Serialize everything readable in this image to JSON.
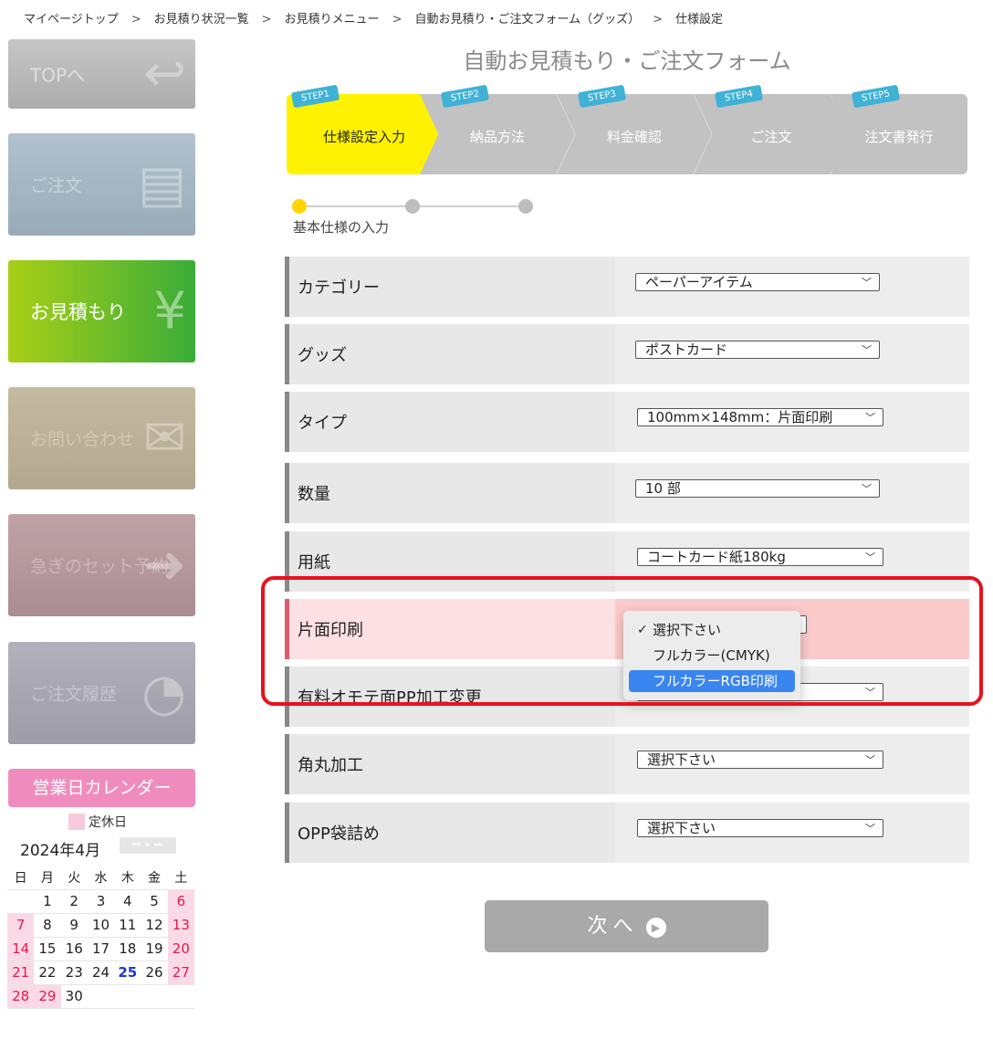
{
  "breadcrumb": {
    "items": [
      "マイページトップ",
      "お見積り状況一覧",
      "お見積りメニュー",
      "自動お見積り・ご注文フォーム（グッズ）",
      "仕様設定"
    ],
    "separator": ">"
  },
  "sidebar": {
    "top": "TOPへ",
    "order": "ご注文",
    "estimate": "お見積もり",
    "contact": "お問い合わせ",
    "rush": "急ぎのセット予約",
    "history": "ご注文履歴"
  },
  "calendar": {
    "title": "営業日カレンダー",
    "legend": "定休日",
    "month": "2024年4月",
    "weekdays": [
      "日",
      "月",
      "火",
      "水",
      "木",
      "金",
      "土"
    ],
    "weeks": [
      [
        "",
        "1",
        "2",
        "3",
        "4",
        "5",
        "6"
      ],
      [
        "7",
        "8",
        "9",
        "10",
        "11",
        "12",
        "13"
      ],
      [
        "14",
        "15",
        "16",
        "17",
        "18",
        "19",
        "20"
      ],
      [
        "21",
        "22",
        "23",
        "24",
        "25",
        "26",
        "27"
      ],
      [
        "28",
        "29",
        "30",
        "",
        "",
        "",
        ""
      ]
    ],
    "holidays": [
      "6",
      "7",
      "13",
      "14",
      "20",
      "21",
      "27",
      "28",
      "29"
    ],
    "today": "25",
    "holiday_color": "#e01a4f",
    "today_color": "#1838d8"
  },
  "form": {
    "title": "自動お見積もり・ご注文フォーム",
    "steps": [
      {
        "tag": "STEP1",
        "name": "仕様設定入力"
      },
      {
        "tag": "STEP2",
        "name": "納品方法"
      },
      {
        "tag": "STEP3",
        "name": "料金確認"
      },
      {
        "tag": "STEP4",
        "name": "ご注文"
      },
      {
        "tag": "STEP5",
        "name": "注文書発行"
      }
    ],
    "progress_label": "基本仕様の入力",
    "rows": [
      {
        "label": "カテゴリー",
        "value": "ペーパーアイテム"
      },
      {
        "label": "グッズ",
        "value": "ポストカード"
      },
      {
        "label": "タイプ",
        "value": "100mm×148mm：片面印刷"
      },
      {
        "label": "数量",
        "value": "10 部"
      },
      {
        "label": "用紙",
        "value": "コートカード紙180kg"
      },
      {
        "label": "片面印刷",
        "value": ""
      },
      {
        "label": "有料オモテ面PP加工変更",
        "value": ""
      },
      {
        "label": "角丸加工",
        "value": "選択下さい"
      },
      {
        "label": "OPP袋詰め",
        "value": "選択下さい"
      }
    ],
    "dropdown_options": [
      {
        "label": "選択下さい",
        "checked": true
      },
      {
        "label": "フルカラー(CMYK)",
        "checked": false
      },
      {
        "label": "フルカラーRGB印刷",
        "highlighted": true
      }
    ],
    "next_button": "次へ"
  },
  "colors": {
    "accent_step": "#fff200",
    "estimate_banner": "#3aac38",
    "highlight": "#3a86f0",
    "annotation": "#e8121d"
  }
}
